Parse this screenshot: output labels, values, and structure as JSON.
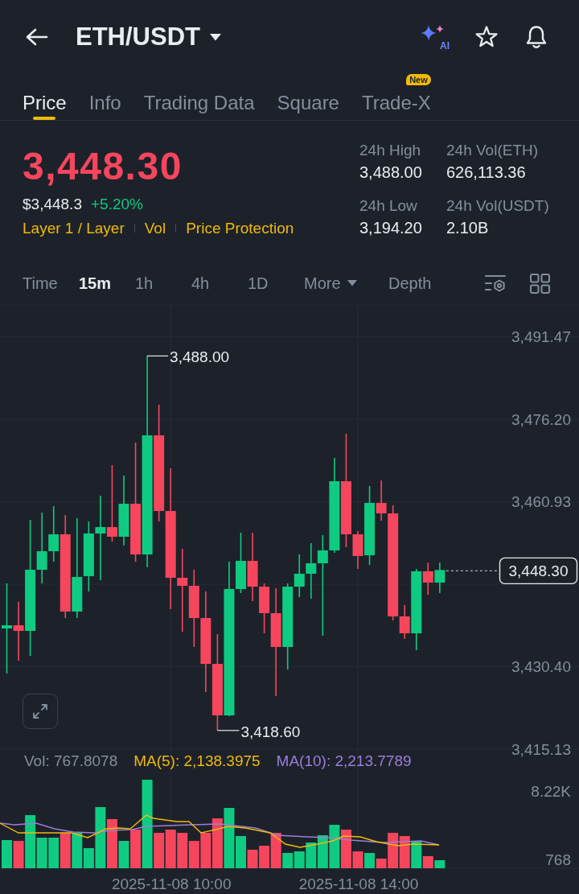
{
  "header": {
    "title": "ETH/USDT",
    "ai_label": "AI",
    "starred": false
  },
  "tabs": [
    {
      "label": "Price",
      "selected": true
    },
    {
      "label": "Info",
      "selected": false
    },
    {
      "label": "Trading Data",
      "selected": false
    },
    {
      "label": "Square",
      "selected": false
    },
    {
      "label": "Trade-X",
      "selected": false,
      "badge": "New"
    }
  ],
  "ticker": {
    "price": "3,448.30",
    "price_falling": true,
    "fiat_price": "$3,448.3",
    "change": "+5.20%",
    "change_positive": true,
    "tags": [
      "Layer 1 / Layer",
      "Vol",
      "Price Protection"
    ]
  },
  "stats": [
    {
      "label": "24h High",
      "value": "3,488.00"
    },
    {
      "label": "24h Vol(ETH)",
      "value": "626,113.36"
    },
    {
      "label": "24h Low",
      "value": "3,194.20"
    },
    {
      "label": "24h Vol(USDT)",
      "value": "2.10B"
    }
  ],
  "intervals": [
    {
      "label": "Time",
      "kind": "option",
      "selected": false
    },
    {
      "label": "15m",
      "kind": "option",
      "selected": true
    },
    {
      "label": "1h",
      "kind": "option",
      "selected": false
    },
    {
      "label": "4h",
      "kind": "option",
      "selected": false
    },
    {
      "label": "1D",
      "kind": "option",
      "selected": false
    },
    {
      "label": "More",
      "kind": "dropdown",
      "selected": false
    },
    {
      "label": "Depth",
      "kind": "option",
      "selected": false
    }
  ],
  "chart": {
    "chart_data": {
      "type": "candlestick",
      "categories": [
        null,
        null,
        null,
        null,
        null,
        null,
        null,
        null,
        null,
        null,
        null,
        null,
        null,
        null,
        null,
        null,
        null,
        null,
        null,
        null,
        null,
        null,
        null,
        null,
        null,
        null,
        null,
        null,
        null,
        null,
        null,
        null,
        null,
        null,
        null,
        null,
        null,
        null
      ],
      "ohlc": [
        [
          3437.48,
          3445.82,
          3429.13,
          3438.07
        ],
        [
          3438.07,
          3442.39,
          3431.52,
          3437.03
        ],
        [
          3437.03,
          3457.59,
          3432.41,
          3448.35
        ],
        [
          3448.35,
          3458.93,
          3445.82,
          3451.78
        ],
        [
          3451.78,
          3460.12,
          3449.84,
          3454.91
        ],
        [
          3454.91,
          3458.48,
          3439.41,
          3440.61
        ],
        [
          3440.61,
          3457.89,
          3439.41,
          3447.01
        ],
        [
          3447.16,
          3457.29,
          3444.33,
          3455.06
        ],
        [
          3455.06,
          3462.06,
          3446.42,
          3456.25
        ],
        [
          3456.25,
          3467.72,
          3453.57,
          3454.46
        ],
        [
          3454.46,
          3465.79,
          3452.82,
          3460.57
        ],
        [
          3460.57,
          3471.89,
          3449.84,
          3451.18
        ],
        [
          3451.18,
          3488.0,
          3448.8,
          3473.23
        ],
        [
          3473.23,
          3478.9,
          3457.29,
          3459.23
        ],
        [
          3459.23,
          3467.13,
          3441.05,
          3446.86
        ],
        [
          3446.86,
          3452.23,
          3436.88,
          3445.37
        ],
        [
          3445.37,
          3448.35,
          3434.05,
          3439.41
        ],
        [
          3439.41,
          3444.33,
          3425.71,
          3430.92
        ],
        [
          3430.92,
          3436.43,
          3418.6,
          3421.39
        ],
        [
          3421.39,
          3449.84,
          3421.24,
          3444.78
        ],
        [
          3444.78,
          3455.21,
          3444.03,
          3449.99
        ],
        [
          3449.99,
          3455.21,
          3442.54,
          3445.22
        ],
        [
          3445.22,
          3445.82,
          3436.58,
          3440.31
        ],
        [
          3440.31,
          3444.93,
          3424.96,
          3434.05
        ],
        [
          3434.05,
          3445.82,
          3429.88,
          3445.22
        ],
        [
          3445.22,
          3451.18,
          3443.29,
          3447.61
        ],
        [
          3447.61,
          3453.27,
          3442.99,
          3449.55
        ],
        [
          3449.55,
          3454.76,
          3436.14,
          3451.93
        ],
        [
          3451.93,
          3469.06,
          3451.48,
          3464.74
        ],
        [
          3464.74,
          3473.53,
          3452.53,
          3454.91
        ],
        [
          3454.91,
          3455.51,
          3448.5,
          3450.89
        ],
        [
          3451.03,
          3463.85,
          3449.25,
          3460.72
        ],
        [
          3460.72,
          3464.89,
          3457.44,
          3458.78
        ],
        [
          3458.78,
          3460.27,
          3438.97,
          3439.71
        ],
        [
          3439.71,
          3441.8,
          3435.54,
          3436.58
        ],
        [
          3436.58,
          3448.5,
          3433.45,
          3448.06
        ],
        [
          3448.06,
          3449.69,
          3443.73,
          3445.97
        ],
        [
          3445.97,
          3449.69,
          3444.03,
          3448.3
        ]
      ],
      "ylim": [
        3412.9,
        3497.22
      ],
      "yticks": [
        {
          "value": 3491.47,
          "label": "3,491.47"
        },
        {
          "value": 3476.2,
          "label": "3,476.20"
        },
        {
          "value": 3460.93,
          "label": "3,460.93"
        },
        {
          "value": 3430.4,
          "label": "3,430.40"
        },
        {
          "value": 3415.13,
          "label": "3,415.13"
        }
      ],
      "grid": true
    },
    "high_label": "3,488.00",
    "low_label": "3,418.60",
    "last_price": "3,448.30",
    "legend": [
      {
        "label": "Vol: 767.8078",
        "color": "#848e9c"
      },
      {
        "label": "MA(5): 2,138.3975",
        "color": "#f0b90b"
      },
      {
        "label": "MA(10): 2,213.7789",
        "color": "#9b7ed9"
      }
    ],
    "volume_axis": [
      "8.22K",
      "768"
    ],
    "time_axis": [
      "2025-11-08 10:00",
      "2025-11-08 14:00"
    ]
  }
}
